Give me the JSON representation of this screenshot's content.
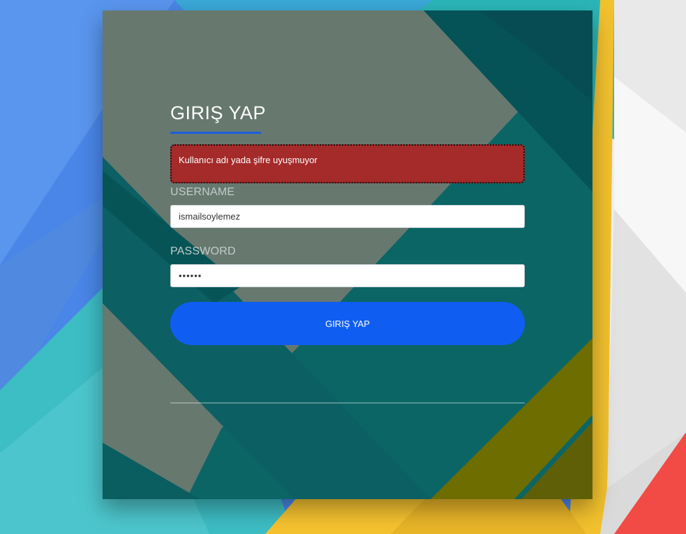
{
  "login": {
    "title": "GIRIŞ YAP",
    "error_message": "Kullanıcı adı yada şifre uyuşmuyor",
    "username_label": "USERNAME",
    "username_value": "ismailsoylemez",
    "password_label": "PASSWORD",
    "password_value": "••••••",
    "submit_label": "GIRIŞ YAP"
  },
  "colors": {
    "accent": "#0f5ef1",
    "underline": "#1a5fe0",
    "error_background": "#a52a2a",
    "card_teal": "#0a6b6b",
    "card_gray": "#67786f",
    "card_olive": "#6d6d00"
  }
}
